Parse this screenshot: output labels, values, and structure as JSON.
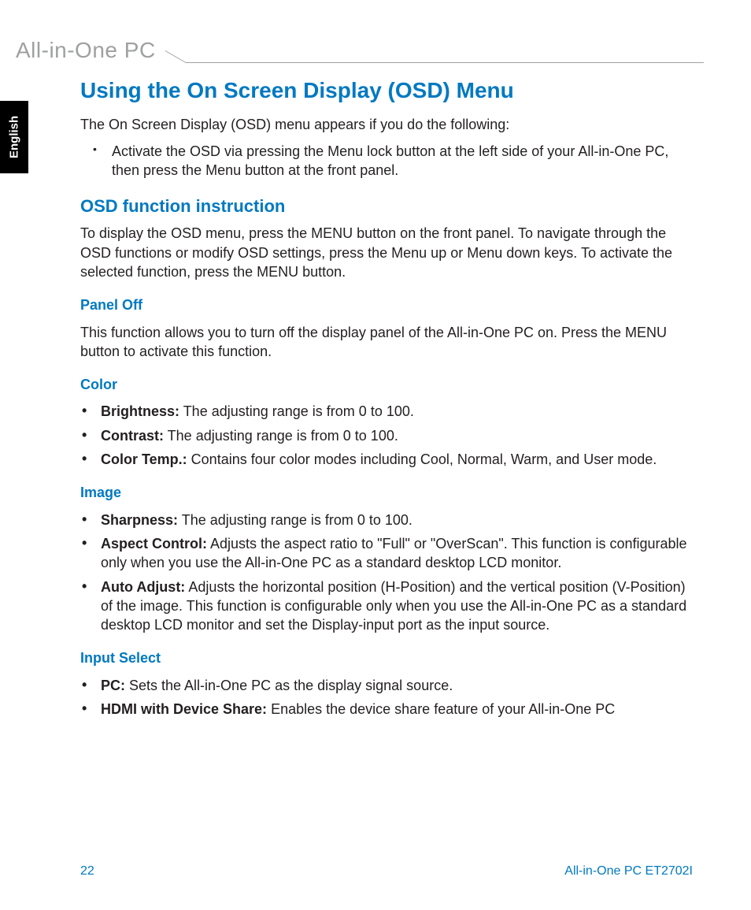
{
  "header": {
    "product_line": "All-in-One PC"
  },
  "lang_tab": "English",
  "main": {
    "title": "Using the On Screen Display (OSD) Menu",
    "intro": "The On Screen Display (OSD) menu appears if you do the following:",
    "intro_bullet": "Activate the OSD via pressing the Menu lock button at the left side of your All-in-One PC, then press the Menu button at the front panel.",
    "osd_func": {
      "heading": "OSD function instruction",
      "text": "To display the OSD menu, press the MENU button on the front panel. To navigate through the OSD functions or modify OSD settings, press the Menu up or Menu down keys. To activate the selected function, press the MENU button."
    },
    "panel_off": {
      "heading": "Panel Off",
      "text": "This function allows you to turn off the display panel of the All-in-One PC on. Press the MENU button to activate this function."
    },
    "color": {
      "heading": "Color",
      "items": [
        {
          "label": "Brightness:",
          "text": " The adjusting range is from 0 to 100."
        },
        {
          "label": "Contrast:",
          "text": " The adjusting range is from 0 to 100."
        },
        {
          "label": "Color Temp.:",
          "text": " Contains four color modes including Cool, Normal, Warm, and User mode."
        }
      ]
    },
    "image": {
      "heading": "Image",
      "items": [
        {
          "label": "Sharpness:",
          "text": " The adjusting range is from 0 to 100."
        },
        {
          "label": "Aspect Control:",
          "text": " Adjusts the aspect ratio to \"Full\" or \"OverScan\". This function is configurable only when you use the All-in-One PC as a standard desktop LCD monitor."
        },
        {
          "label": "Auto Adjust:",
          "text": " Adjusts the horizontal position (H-Position) and the vertical position (V-Position) of the image. This function is configurable only when you use the All-in-One PC as a standard desktop LCD monitor and set the Display-input port as the input source."
        }
      ]
    },
    "input_select": {
      "heading": "Input Select",
      "items": [
        {
          "label": "PC:",
          "text": " Sets the All-in-One PC as the display signal source."
        },
        {
          "label": "HDMI with Device Share:",
          "text": " Enables the device share feature of your All-in-One PC"
        }
      ]
    }
  },
  "footer": {
    "page": "22",
    "model": "All-in-One PC ET2702I"
  }
}
